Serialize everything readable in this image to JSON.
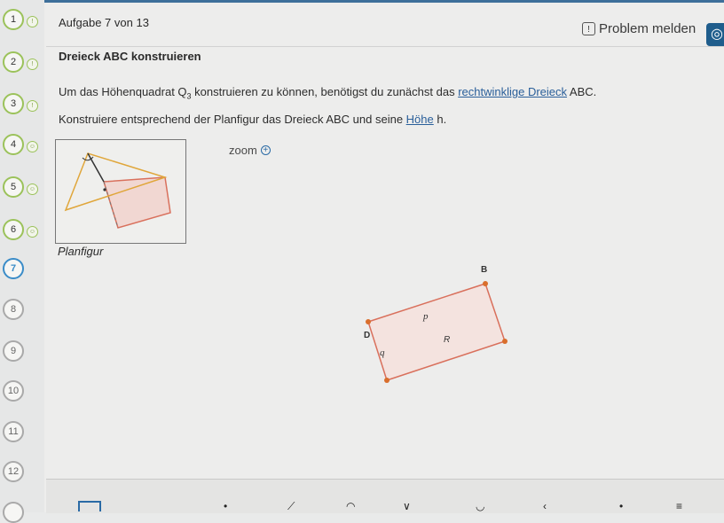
{
  "sidebar": {
    "tasks": [
      {
        "label": "1",
        "state": "done",
        "icon": "1"
      },
      {
        "label": "2",
        "state": "done",
        "icon": "1"
      },
      {
        "label": "3",
        "state": "done",
        "icon": "1"
      },
      {
        "label": "4",
        "state": "done",
        "icon": "smiley"
      },
      {
        "label": "5",
        "state": "done",
        "icon": "smiley"
      },
      {
        "label": "6",
        "state": "done",
        "icon": "smiley"
      },
      {
        "label": "7",
        "state": "current"
      },
      {
        "label": "8",
        "state": "open"
      },
      {
        "label": "9",
        "state": "open"
      },
      {
        "label": "10",
        "state": "open"
      },
      {
        "label": "11",
        "state": "open"
      },
      {
        "label": "12",
        "state": "open"
      }
    ]
  },
  "header": {
    "counter": "Aufgabe 7 von 13",
    "report_label": "Problem melden",
    "report_icon": "flag-icon",
    "rescue_icon": "lifebuoy-icon"
  },
  "task": {
    "title": "Dreieck ABC konstruieren",
    "instruction_line1_pre": "Um das Höhenquadrat Q",
    "instruction_line1_sub": "3",
    "instruction_line1_mid": " konstruieren zu können, benötigst du zunächst das ",
    "instruction_line1_link": "rechtwinklige Dreieck",
    "instruction_line1_post": " ABC.",
    "instruction_line2_pre": "Konstruiere entsprechend der Planfigur das Dreieck ABC und seine ",
    "instruction_line2_link": "Höhe",
    "instruction_line2_post": " h.",
    "sketch_caption": "Planfigur",
    "zoom_label": "zoom",
    "zoom_icon": "zoom-in-icon"
  },
  "construction": {
    "labels": {
      "B": "B",
      "D": "D",
      "p": "p",
      "q": "q",
      "R": "R"
    }
  },
  "colors": {
    "accent": "#3a8cc8",
    "done": "#9bc25a",
    "triangle": "#e0a63a",
    "square": "#d9705c",
    "point": "#d96e2c"
  }
}
